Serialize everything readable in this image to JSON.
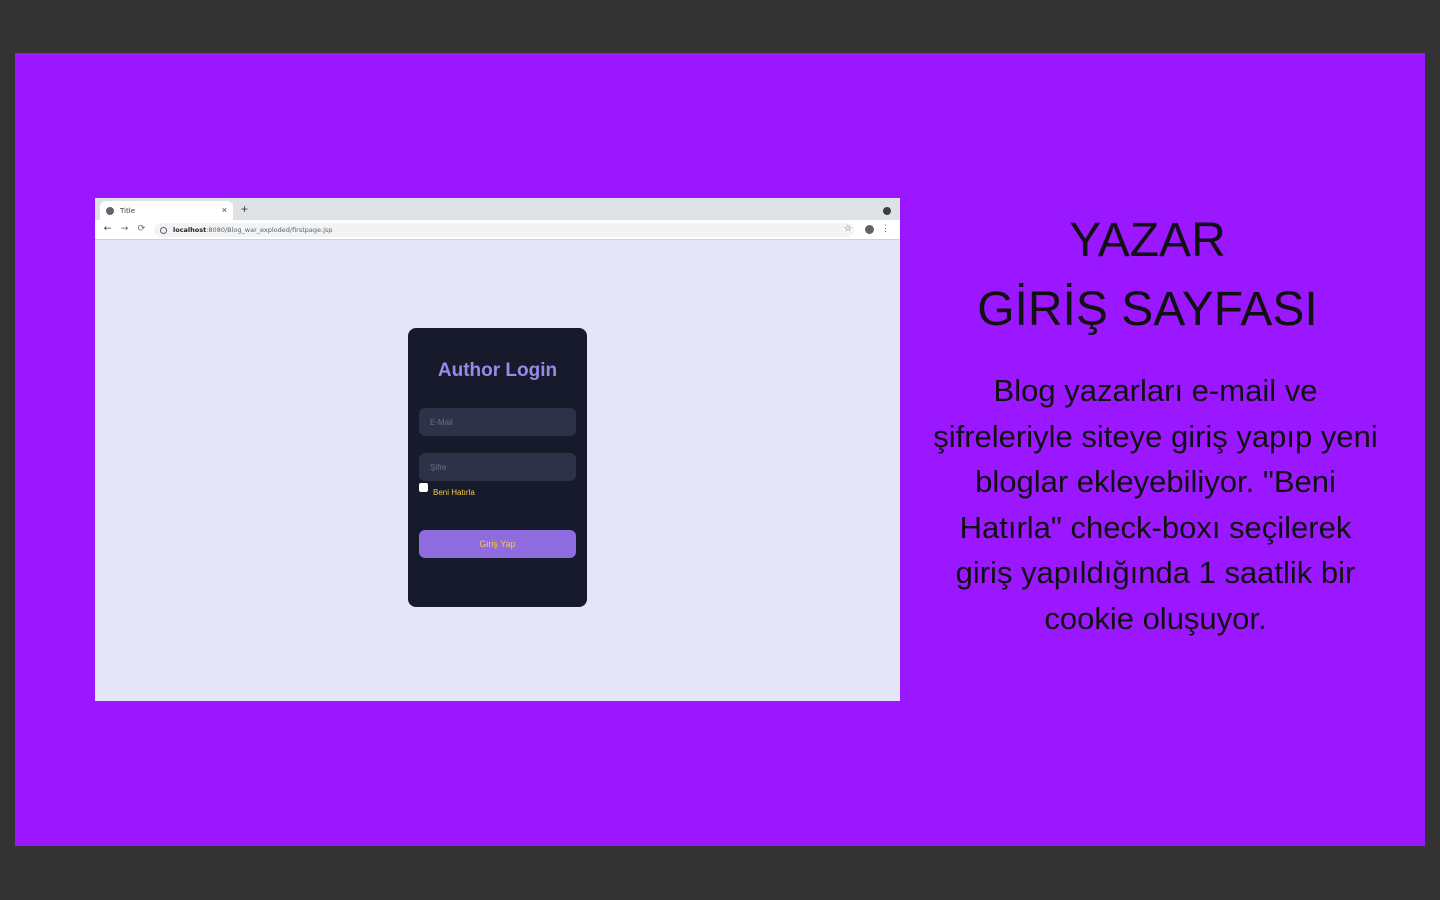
{
  "browser": {
    "tab_title": "Title",
    "tab_close": "×",
    "new_tab": "+",
    "nav_back": "←",
    "nav_forward": "→",
    "nav_reload": "⟳",
    "url_host": "localhost",
    "url_path": ":8080/Blog_war_exploded/firstpage.jsp",
    "star": "☆",
    "menu": "⋮"
  },
  "login": {
    "title": "Author Login",
    "email_placeholder": "E-Mail",
    "password_placeholder": "Şifre",
    "remember_label": "Beni Hatırla",
    "submit_label": "Giriş Yap"
  },
  "slide": {
    "heading_line1": "YAZAR",
    "heading_line2": "GİRİŞ SAYFASI",
    "description": "Blog yazarları e-mail ve şifreleriyle siteye giriş yapıp yeni bloglar ekleyebiliyor. \"Beni Hatırla\" check-boxı seçilerek giriş yapıldığında 1 saatlik bir cookie oluşuyor."
  },
  "colors": {
    "slide_bg": "#9b17ff",
    "frame_bg": "#333333",
    "page_bg": "#e5e5f8",
    "card_bg": "#161a2b",
    "title_color": "#9b88e8",
    "button_bg": "#8f6be0",
    "accent_text": "#f5c84a"
  },
  "icons": [
    "globe-icon",
    "close-icon",
    "plus-icon",
    "arrow-left-icon",
    "arrow-right-icon",
    "reload-icon",
    "info-icon",
    "star-icon",
    "profile-icon",
    "kebab-menu-icon",
    "window-control-icon"
  ]
}
